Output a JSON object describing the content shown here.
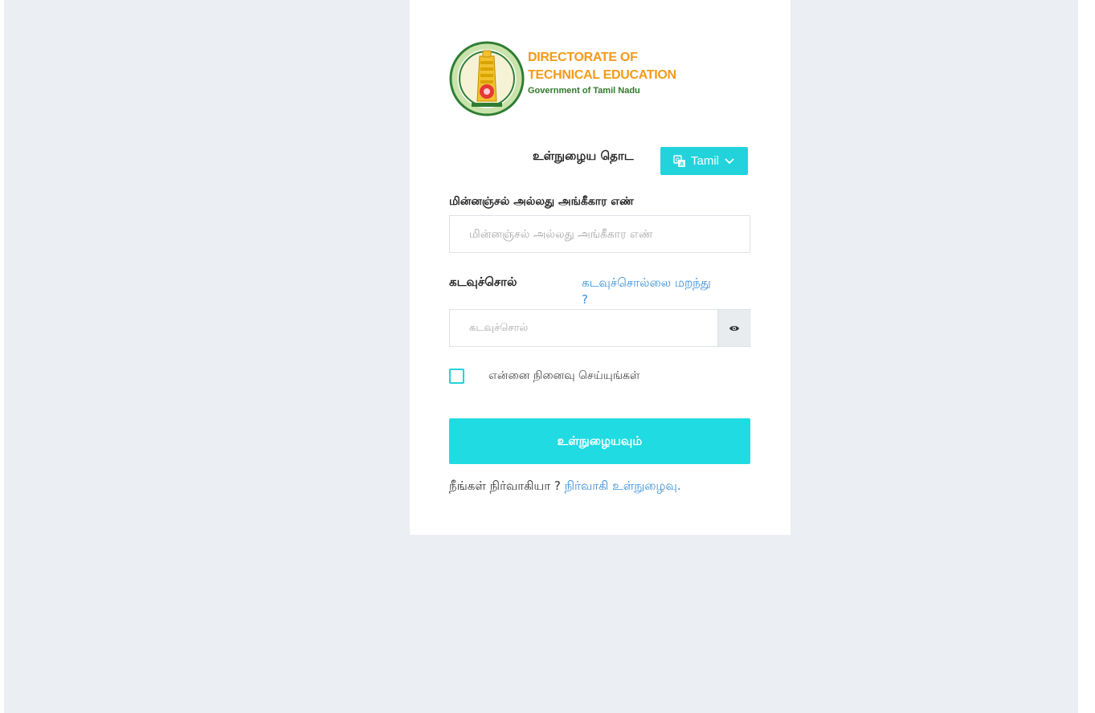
{
  "logo": {
    "line1": "DIRECTORATE OF",
    "line2": "TECHNICAL EDUCATION",
    "line3": "Government of Tamil Nadu",
    "emblem_icon": "tamil-nadu-emblem-icon",
    "colors": {
      "title": "#f39a18",
      "subtitle": "#2f7a2a"
    }
  },
  "header": {
    "title": "உள்நுழைய தொட",
    "language_button": {
      "label": "Tamil",
      "icon": "translate-icon",
      "caret": "chevron-down-icon"
    }
  },
  "form": {
    "email": {
      "label": "மின்னஞ்சல் அல்லது அங்கீகார எண்",
      "placeholder": "மின்னஞ்சல் அல்லது அங்கீகார எண்",
      "value": ""
    },
    "password": {
      "label": "கடவுச்சொல்",
      "placeholder": "கடவுச்சொல்",
      "value": "",
      "forgot_link": "கடவுச்சொல்லை மறந்து ?",
      "toggle_icon": "eye-icon"
    },
    "remember": {
      "label": "என்னை நினைவு செய்யுங்கள்",
      "checked": false
    },
    "submit_label": "உள்நுழையவும்"
  },
  "footer": {
    "admin_question": "நீங்கள் நிர்வாகியா ? ",
    "admin_link": "நிர்வாகி உள்நுழைவு."
  },
  "colors": {
    "accent": "#22d3dc",
    "link": "#3a8fd8",
    "page_background": "#ebeef2"
  }
}
